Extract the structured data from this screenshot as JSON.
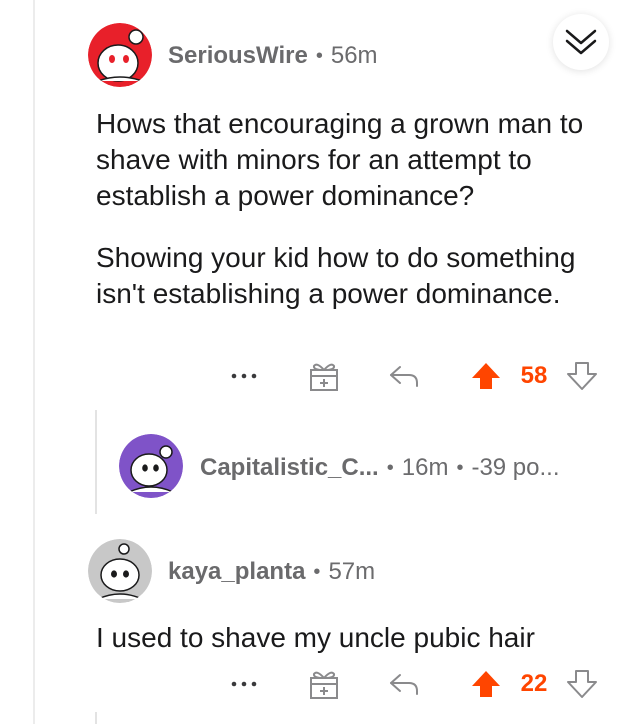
{
  "comments": [
    {
      "username": "SeriousWire",
      "age": "56m",
      "avatar_color": "#e8202a",
      "paragraphs": [
        "Hows that encouraging a grown man to shave with minors for an attempt to establish a power dominance?",
        "Showing your kid how to do something isn't establishing a power dominance."
      ],
      "score": "58"
    },
    {
      "username": "Capitalistic_C...",
      "age": "16m",
      "points": "-39 po...",
      "avatar_color": "#7f53c8",
      "collapsed": true
    },
    {
      "username": "kaya_planta",
      "age": "57m",
      "avatar_color": "#c8c8c8",
      "paragraphs": [
        "I used to shave my uncle pubic hair"
      ],
      "score": "22"
    }
  ],
  "dot_separator": "•",
  "icons": {
    "collapse": "chevron-double-down-icon",
    "more": "more-dots-icon",
    "award": "award-gift-icon",
    "reply": "reply-arrow-icon",
    "upvote": "upvote-arrow-icon",
    "downvote": "downvote-arrow-icon"
  },
  "colors": {
    "upvote": "#ff4500",
    "meta_text": "#6b6b6d",
    "icon_gray": "#8a8a8c"
  }
}
